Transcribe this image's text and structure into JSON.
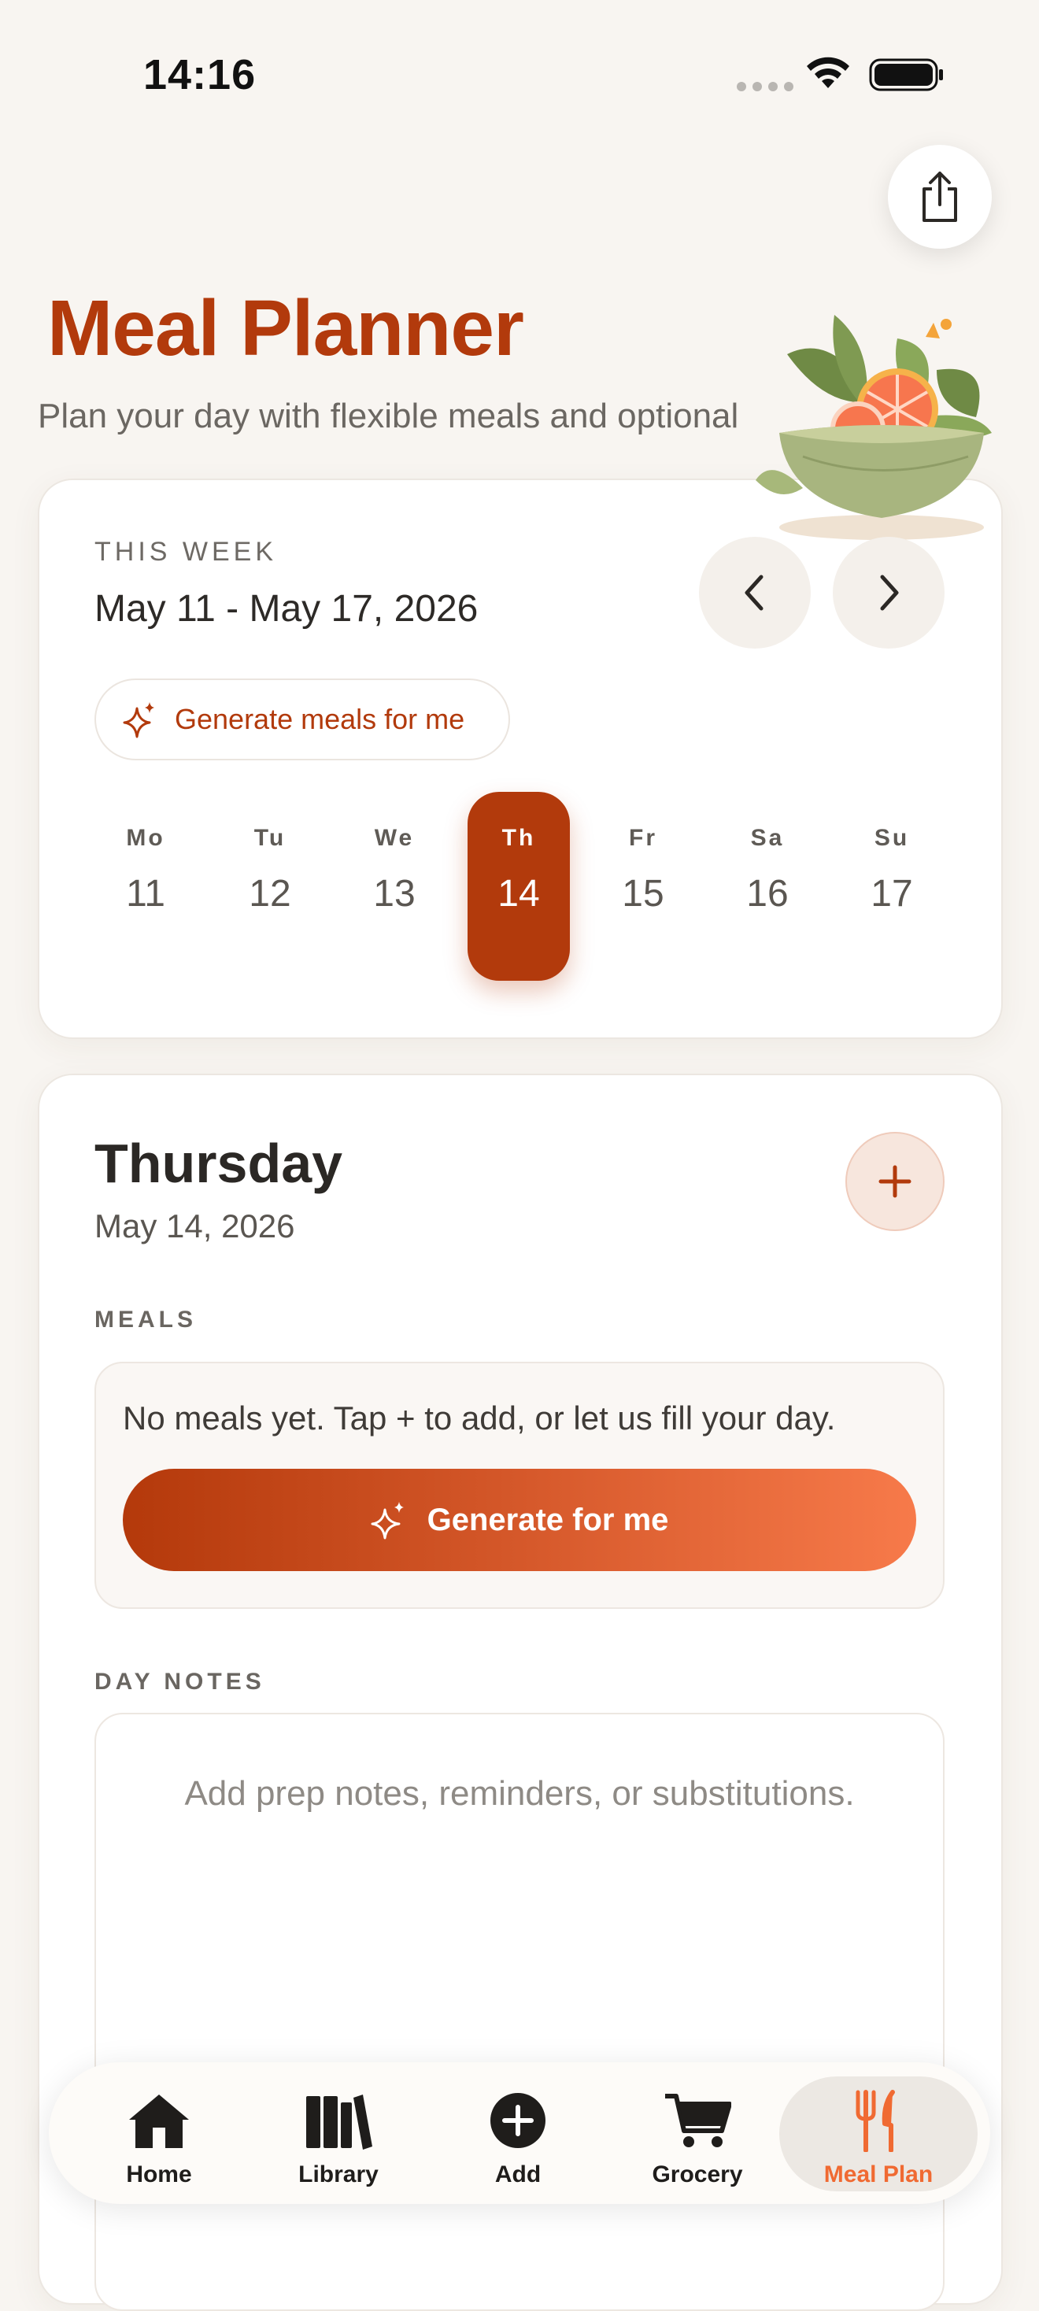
{
  "status_bar": {
    "time": "14:16"
  },
  "header": {
    "title": "Meal Planner",
    "subtitle": "Plan your day with flexible meals and optional"
  },
  "week": {
    "label": "THIS WEEK",
    "range": "May 11 - May 17, 2026",
    "generate_label": "Generate meals for me",
    "days": [
      {
        "abbr": "Mo",
        "num": "11"
      },
      {
        "abbr": "Tu",
        "num": "12"
      },
      {
        "abbr": "We",
        "num": "13"
      },
      {
        "abbr": "Th",
        "num": "14",
        "selected": true
      },
      {
        "abbr": "Fr",
        "num": "15"
      },
      {
        "abbr": "Sa",
        "num": "16"
      },
      {
        "abbr": "Su",
        "num": "17"
      }
    ]
  },
  "day": {
    "name": "Thursday",
    "date": "May 14, 2026",
    "meals_label": "MEALS",
    "empty_text": "No meals yet. Tap + to add, or let us fill your day.",
    "generate_button": "Generate for me",
    "notes_label": "DAY NOTES",
    "notes_placeholder": "Add prep notes, reminders, or substitutions.",
    "notes_value": ""
  },
  "tabs": [
    {
      "label": "Home",
      "icon": "home-icon"
    },
    {
      "label": "Library",
      "icon": "library-icon"
    },
    {
      "label": "Add",
      "icon": "add-icon"
    },
    {
      "label": "Grocery",
      "icon": "cart-icon"
    },
    {
      "label": "Meal Plan",
      "icon": "utensils-icon",
      "active": true
    }
  ],
  "colors": {
    "accent": "#b23a0c",
    "accent_light": "#f77a4a",
    "background": "#f8f5f1",
    "active_tab": "#f06a32"
  }
}
